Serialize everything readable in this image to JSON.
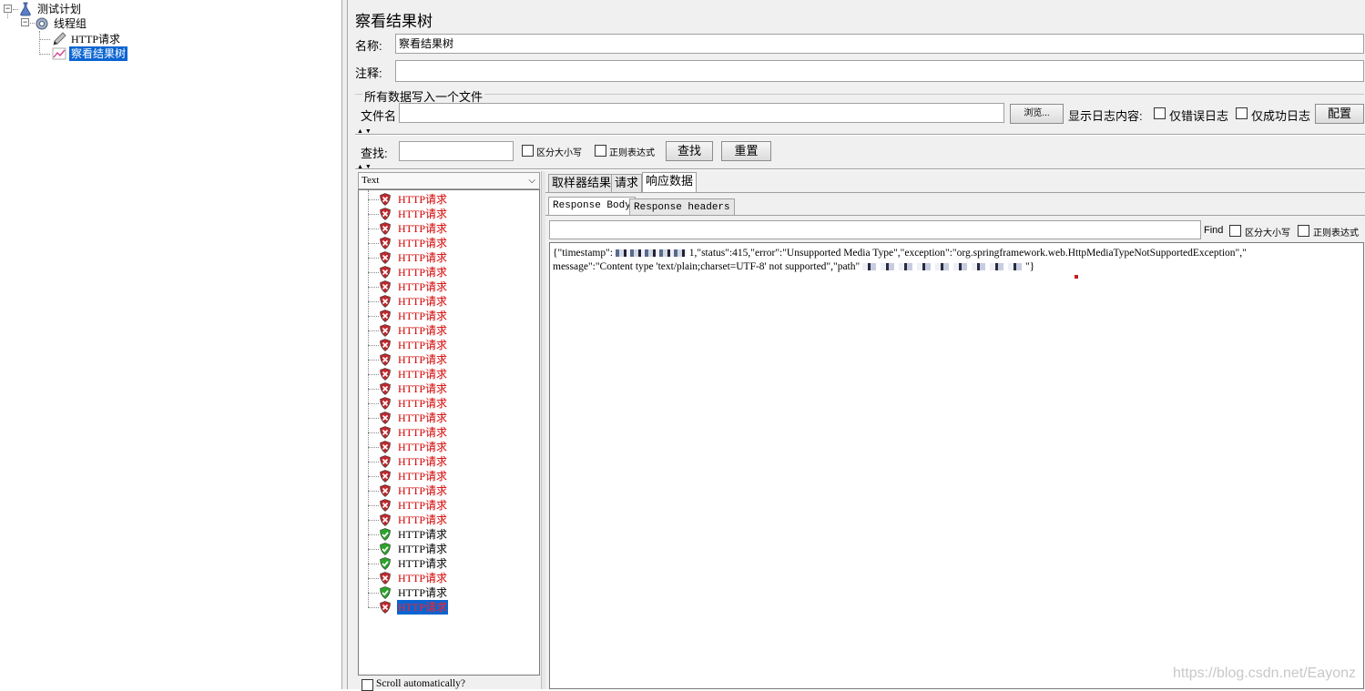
{
  "tree": {
    "test_plan": "测试计划",
    "thread_group": "线程组",
    "http_request": "HTTP请求",
    "view_results_tree": "察看结果树"
  },
  "panel": {
    "title": "察看结果树",
    "name_label": "名称:",
    "name_value": "察看结果树",
    "comment_label": "注释:",
    "comment_value": "",
    "file_section_title": "所有数据写入一个文件",
    "filename_label": "文件名",
    "filename_value": "",
    "browse_button": "浏览...",
    "log_content_label": "显示日志内容:",
    "errors_only": "仅错误日志",
    "success_only": "仅成功日志",
    "config_button": "配置"
  },
  "search": {
    "label": "查找:",
    "value": "",
    "case_sensitive": "区分大小写",
    "regex": "正则表达式",
    "find_button": "查找",
    "reset_button": "重置"
  },
  "renderer": {
    "selected": "Text"
  },
  "results": [
    {
      "label": "HTTP请求",
      "status": "fail"
    },
    {
      "label": "HTTP请求",
      "status": "fail"
    },
    {
      "label": "HTTP请求",
      "status": "fail"
    },
    {
      "label": "HTTP请求",
      "status": "fail"
    },
    {
      "label": "HTTP请求",
      "status": "fail"
    },
    {
      "label": "HTTP请求",
      "status": "fail"
    },
    {
      "label": "HTTP请求",
      "status": "fail"
    },
    {
      "label": "HTTP请求",
      "status": "fail"
    },
    {
      "label": "HTTP请求",
      "status": "fail"
    },
    {
      "label": "HTTP请求",
      "status": "fail"
    },
    {
      "label": "HTTP请求",
      "status": "fail"
    },
    {
      "label": "HTTP请求",
      "status": "fail"
    },
    {
      "label": "HTTP请求",
      "status": "fail"
    },
    {
      "label": "HTTP请求",
      "status": "fail"
    },
    {
      "label": "HTTP请求",
      "status": "fail"
    },
    {
      "label": "HTTP请求",
      "status": "fail"
    },
    {
      "label": "HTTP请求",
      "status": "fail"
    },
    {
      "label": "HTTP请求",
      "status": "fail"
    },
    {
      "label": "HTTP请求",
      "status": "fail"
    },
    {
      "label": "HTTP请求",
      "status": "fail"
    },
    {
      "label": "HTTP请求",
      "status": "fail"
    },
    {
      "label": "HTTP请求",
      "status": "fail"
    },
    {
      "label": "HTTP请求",
      "status": "fail"
    },
    {
      "label": "HTTP请求",
      "status": "ok"
    },
    {
      "label": "HTTP请求",
      "status": "ok"
    },
    {
      "label": "HTTP请求",
      "status": "ok"
    },
    {
      "label": "HTTP请求",
      "status": "fail"
    },
    {
      "label": "HTTP请求",
      "status": "ok"
    },
    {
      "label": "HTTP请求",
      "status": "fail",
      "selected": true
    }
  ],
  "scroll_auto": "Scroll automatically?",
  "tabs": [
    "取样器结果",
    "请求",
    "响应数据"
  ],
  "active_tab": "响应数据",
  "subtabs": [
    "Response Body",
    "Response headers"
  ],
  "find": {
    "label": "Find",
    "case_sensitive": "区分大小写",
    "regex": "正则表达式",
    "value": ""
  },
  "response": {
    "line1_a": "{\"timestamp\":",
    "line1_b": "1,\"status\":415,\"error\":\"Unsupported Media Type\",\"exception\":\"org.springframework.web.HttpMediaTypeNotSupportedException\",\"",
    "line2_a": "message\":\"Content type 'text/plain;charset=UTF-8' not supported\",\"path\"",
    "line2_b": "\"}"
  },
  "watermark": "https://blog.csdn.net/Eayonz",
  "colors": {
    "selection": "#0a64d2",
    "fail_text": "#d40000",
    "fail_icon": "#c0282d",
    "ok_icon": "#2aa52a"
  }
}
